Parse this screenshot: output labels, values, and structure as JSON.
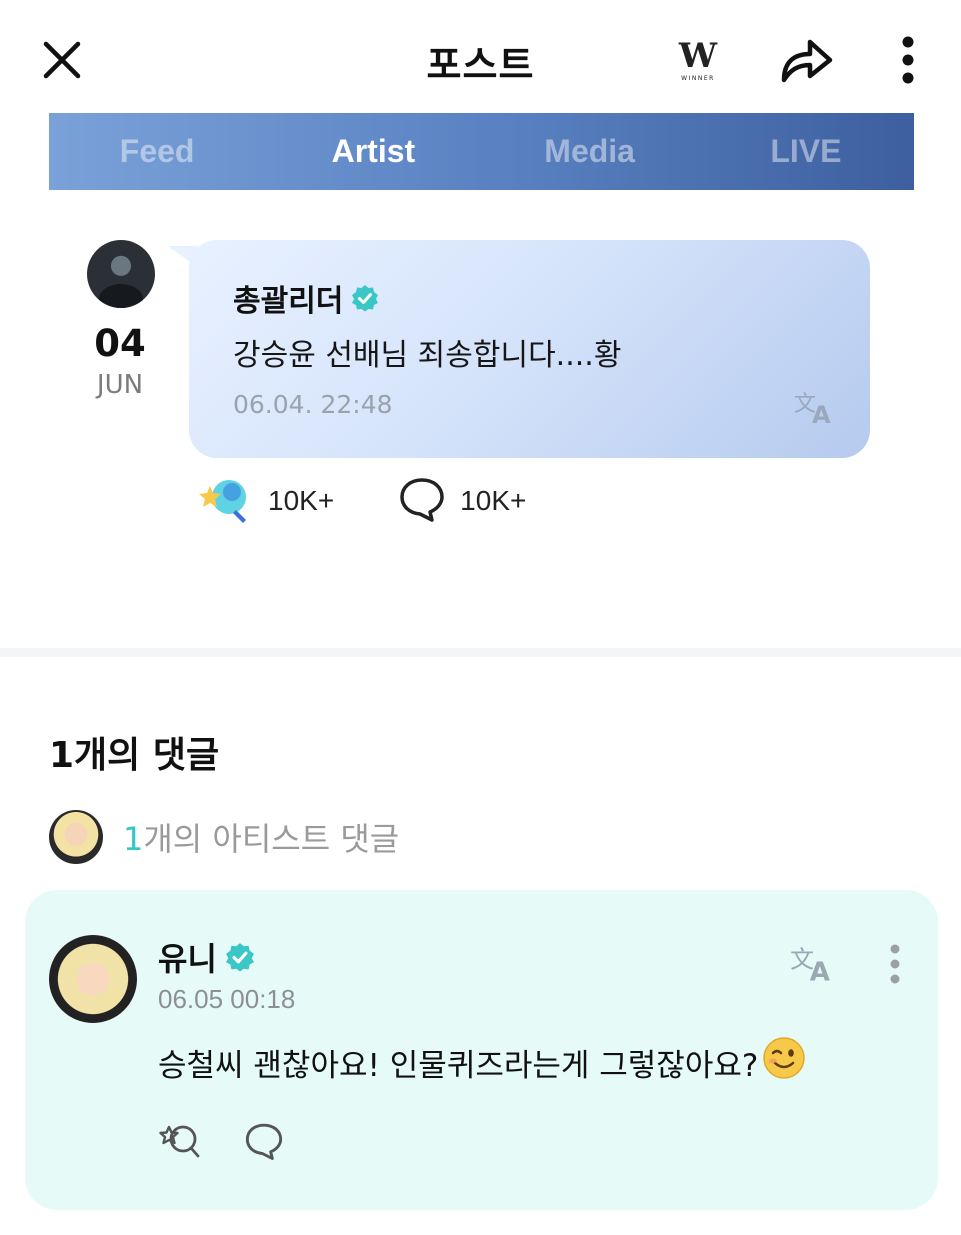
{
  "header": {
    "title": "포스트",
    "logo_letter": "W",
    "logo_text": "WINNER"
  },
  "tabs": [
    {
      "label": "Feed",
      "active": false
    },
    {
      "label": "Artist",
      "active": true
    },
    {
      "label": "Media",
      "active": false
    },
    {
      "label": "LIVE",
      "active": false
    }
  ],
  "post": {
    "date_day": "04",
    "date_month": "JUN",
    "author": "총괄리더",
    "text": "강승윤 선배님 죄송합니다....황",
    "time": "06.04. 22:48",
    "reaction_count": "10K+",
    "comment_count": "10K+"
  },
  "comments": {
    "title": "1개의 댓글",
    "artist_summary_count": "1",
    "artist_summary_text": "개의 아티스트 댓글",
    "item": {
      "author": "유니",
      "time": "06.05 00:18",
      "text": "승철씨 괜찮아요! 인물퀴즈라는게 그렇잖아요?"
    }
  },
  "colors": {
    "tab_gradient_start": "#7aa1d8",
    "tab_gradient_end": "#3d5f9f",
    "verified": "#3cc7c7",
    "comment_bg": "#e6fbf8",
    "accent_teal": "#35c6c6"
  },
  "icons": [
    "close-icon",
    "winner-logo",
    "share-icon",
    "more-vertical-icon",
    "verified-badge-icon",
    "translate-icon",
    "reaction-icon",
    "comment-icon",
    "wink-emoji"
  ]
}
